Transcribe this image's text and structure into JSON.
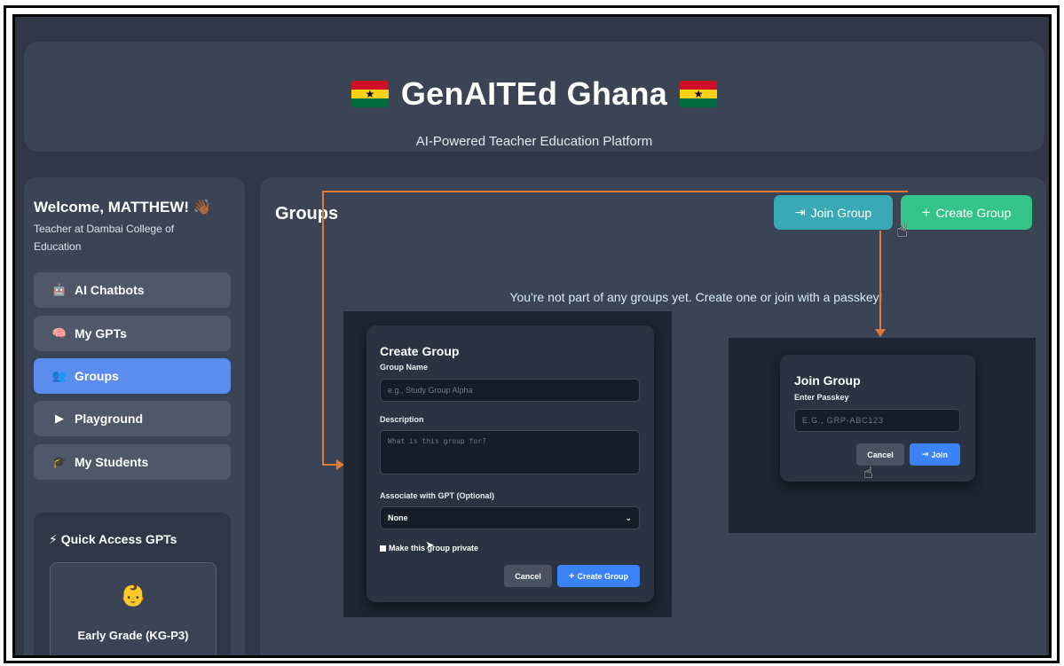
{
  "header": {
    "title": "GenAITEd Ghana",
    "tagline": "AI-Powered Teacher Education Platform",
    "flag_icon": "ghana-flag-icon"
  },
  "sidebar": {
    "welcome": "Welcome, MATTHEW! 👋🏾",
    "subtitle": "Teacher at Dambai College of Education",
    "items": [
      {
        "label": "AI Chatbots",
        "icon": "🤖"
      },
      {
        "label": "My GPTs",
        "icon": "🧠"
      },
      {
        "label": "Groups",
        "icon": "👥"
      },
      {
        "label": "Playground",
        "icon": "▶"
      },
      {
        "label": "My Students",
        "icon": "🎓"
      }
    ],
    "quick_access": {
      "title": "⚡ Quick Access GPTs",
      "card_emoji": "👶",
      "card_name": "Early Grade (KG-P3)"
    }
  },
  "main": {
    "title": "Groups",
    "join_button": "Join Group",
    "join_icon": "⇥",
    "create_button": "Create Group",
    "create_icon": "+",
    "empty_message": "You're not part of any groups yet. Create one or join with a passkey!"
  },
  "create_modal": {
    "title": "Create Group",
    "name_label": "Group Name",
    "name_placeholder": "e.g., Study Group Alpha",
    "description_label": "Description",
    "description_placeholder": "What is this group for?",
    "gpt_label": "Associate with GPT (Optional)",
    "gpt_selected": "None",
    "private_label": "Make this group private",
    "cancel": "Cancel",
    "submit": "Create Group",
    "submit_icon": "+"
  },
  "join_modal": {
    "title": "Join Group",
    "passkey_label": "Enter Passkey",
    "passkey_placeholder": "E.G., GRP-ABC123",
    "cancel": "Cancel",
    "join": "Join",
    "join_icon": "⇥"
  },
  "colors": {
    "accent_blue": "#5b8def",
    "join_teal": "#39a9b6",
    "create_green": "#34c488",
    "annotation_orange": "#e07a3a"
  }
}
